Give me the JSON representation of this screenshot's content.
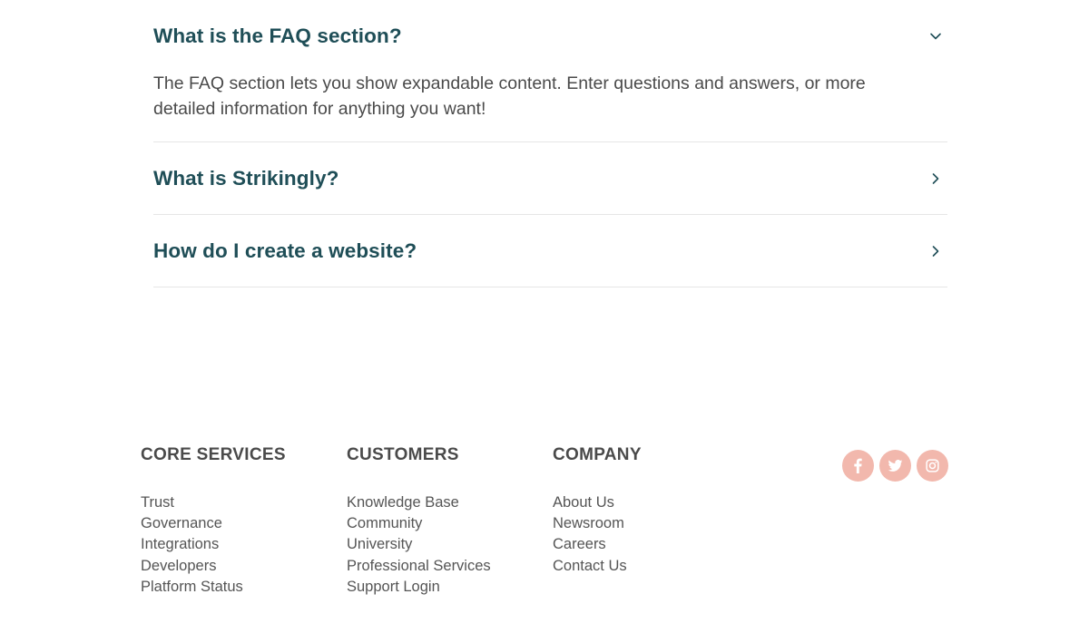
{
  "faq": {
    "items": [
      {
        "question": "What is the FAQ section?",
        "answer": "The FAQ section lets you show expandable content. Enter questions and answers, or more detailed information for anything you want!",
        "expanded": true,
        "icon": "chevron-down-icon"
      },
      {
        "question": "What is Strikingly?",
        "answer": "",
        "expanded": false,
        "icon": "chevron-right-icon"
      },
      {
        "question": "How do I create a website?",
        "answer": "",
        "expanded": false,
        "icon": "chevron-right-icon"
      }
    ]
  },
  "footer": {
    "columns": [
      {
        "heading": "CORE SERVICES",
        "links": [
          "Trust",
          "Governance",
          "Integrations",
          "Developers",
          "Platform Status"
        ]
      },
      {
        "heading": "CUSTOMERS",
        "links": [
          "Knowledge Base",
          "Community",
          "University",
          "Professional Services",
          "Support Login"
        ]
      },
      {
        "heading": "COMPANY",
        "links": [
          "About Us",
          "Newsroom",
          "Careers",
          "Contact Us"
        ]
      }
    ],
    "social": [
      "facebook-icon",
      "twitter-icon",
      "instagram-icon"
    ]
  },
  "colors": {
    "heading": "#1f4e57",
    "social_bg": "#f2b8ad",
    "divider": "#e6e6e6"
  }
}
